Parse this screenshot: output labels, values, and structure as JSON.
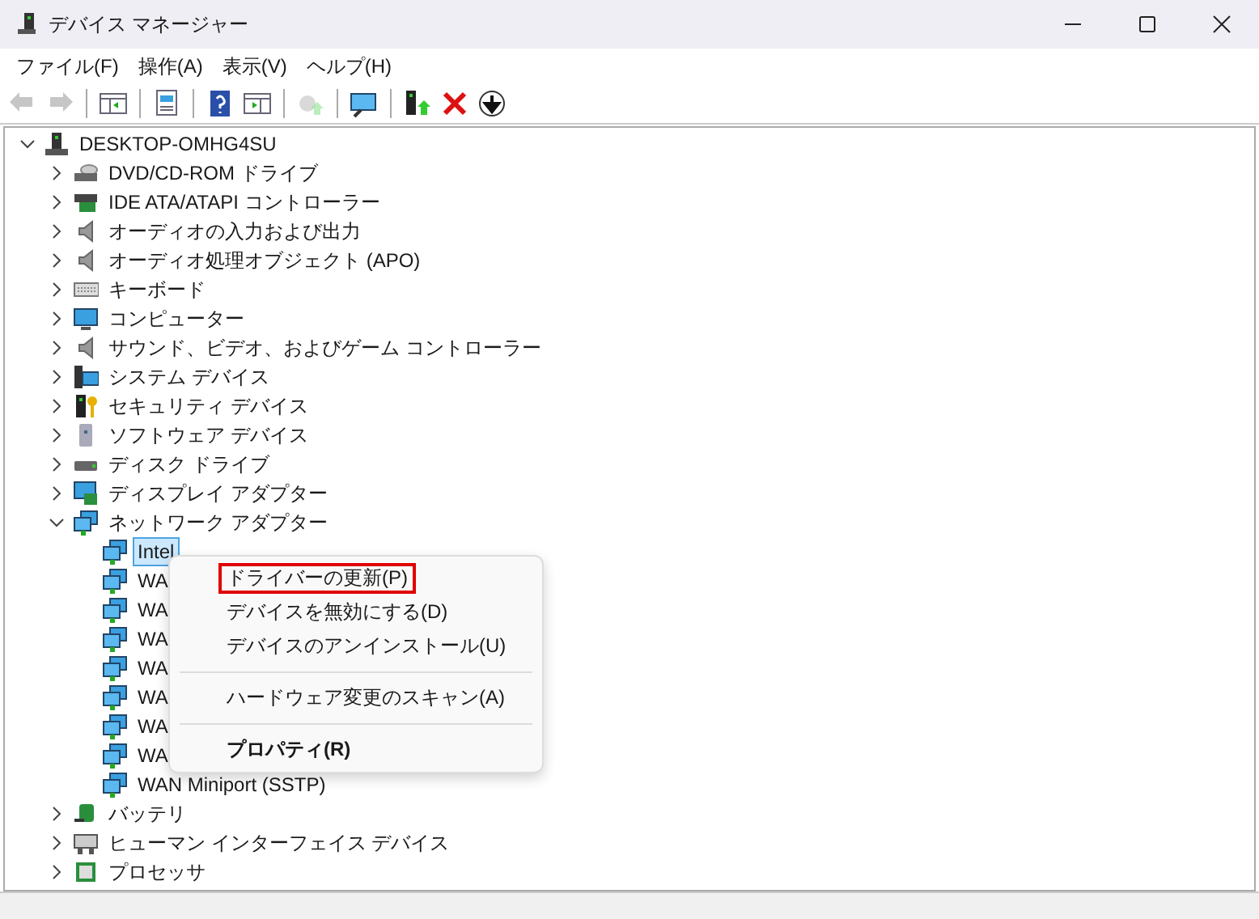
{
  "window": {
    "title": "デバイス マネージャー"
  },
  "menu_bar": [
    "ファイル(F)",
    "操作(A)",
    "表示(V)",
    "ヘルプ(H)"
  ],
  "toolbar": [
    {
      "kind": "back",
      "disabled": true
    },
    {
      "kind": "forward",
      "disabled": true
    },
    {
      "kind": "sep"
    },
    {
      "kind": "tree-pane",
      "disabled": false
    },
    {
      "kind": "sep"
    },
    {
      "kind": "properties",
      "disabled": false
    },
    {
      "kind": "sep"
    },
    {
      "kind": "help",
      "disabled": false
    },
    {
      "kind": "action-pane",
      "disabled": false
    },
    {
      "kind": "sep"
    },
    {
      "kind": "update",
      "disabled": true
    },
    {
      "kind": "sep"
    },
    {
      "kind": "scan",
      "disabled": false
    },
    {
      "kind": "sep"
    },
    {
      "kind": "enable",
      "disabled": false
    },
    {
      "kind": "uninstall",
      "disabled": false
    },
    {
      "kind": "disable",
      "disabled": false
    }
  ],
  "tree": [
    {
      "label": "DESKTOP-OMHG4SU",
      "kind": "pc",
      "expanded": true,
      "selected": false,
      "children": [
        {
          "label": "DVD/CD-ROM ドライブ",
          "kind": "dvd",
          "expanded": false,
          "selected": false
        },
        {
          "label": "IDE ATA/ATAPI コントローラー",
          "kind": "card",
          "expanded": false,
          "selected": false
        },
        {
          "label": "オーディオの入力および出力",
          "kind": "speaker",
          "expanded": false,
          "selected": false
        },
        {
          "label": "オーディオ処理オブジェクト (APO)",
          "kind": "speaker",
          "expanded": false,
          "selected": false
        },
        {
          "label": "キーボード",
          "kind": "keyboard",
          "expanded": false,
          "selected": false
        },
        {
          "label": "コンピューター",
          "kind": "monitor",
          "expanded": false,
          "selected": false
        },
        {
          "label": "サウンド、ビデオ、およびゲーム コントローラー",
          "kind": "speaker",
          "expanded": false,
          "selected": false
        },
        {
          "label": "システム デバイス",
          "kind": "system",
          "expanded": false,
          "selected": false
        },
        {
          "label": "セキュリティ デバイス",
          "kind": "security",
          "expanded": false,
          "selected": false
        },
        {
          "label": "ソフトウェア デバイス",
          "kind": "software",
          "expanded": false,
          "selected": false
        },
        {
          "label": "ディスク ドライブ",
          "kind": "disk",
          "expanded": false,
          "selected": false
        },
        {
          "label": "ディスプレイ アダプター",
          "kind": "display",
          "expanded": false,
          "selected": false
        },
        {
          "label": "ネットワーク アダプター",
          "kind": "network",
          "expanded": true,
          "selected": false,
          "children": [
            {
              "label": "Intel",
              "kind": "network",
              "selected": true
            },
            {
              "label": "WA",
              "kind": "network",
              "selected": false
            },
            {
              "label": "WA",
              "kind": "network",
              "selected": false
            },
            {
              "label": "WA",
              "kind": "network",
              "selected": false
            },
            {
              "label": "WA",
              "kind": "network",
              "selected": false
            },
            {
              "label": "WA",
              "kind": "network",
              "selected": false
            },
            {
              "label": "WA",
              "kind": "network",
              "selected": false
            },
            {
              "label": "WA",
              "kind": "network",
              "selected": false
            },
            {
              "label": "WAN Miniport (SSTP)",
              "kind": "network",
              "selected": false
            }
          ]
        },
        {
          "label": "バッテリ",
          "kind": "battery",
          "expanded": false,
          "selected": false
        },
        {
          "label": "ヒューマン インターフェイス デバイス",
          "kind": "hid",
          "expanded": false,
          "selected": false
        },
        {
          "label": "プロセッサ",
          "kind": "cpu",
          "expanded": false,
          "selected": false
        }
      ]
    }
  ],
  "context_menu": [
    {
      "kind": "item",
      "label": "ドライバーの更新(P)",
      "marked": true,
      "bold": false
    },
    {
      "kind": "item",
      "label": "デバイスを無効にする(D)",
      "marked": false,
      "bold": false
    },
    {
      "kind": "item",
      "label": "デバイスのアンインストール(U)",
      "marked": false,
      "bold": false
    },
    {
      "kind": "separator"
    },
    {
      "kind": "item",
      "label": "ハードウェア変更のスキャン(A)",
      "marked": false,
      "bold": false
    },
    {
      "kind": "separator"
    },
    {
      "kind": "item",
      "label": "プロパティ(R)",
      "marked": false,
      "bold": true
    }
  ]
}
